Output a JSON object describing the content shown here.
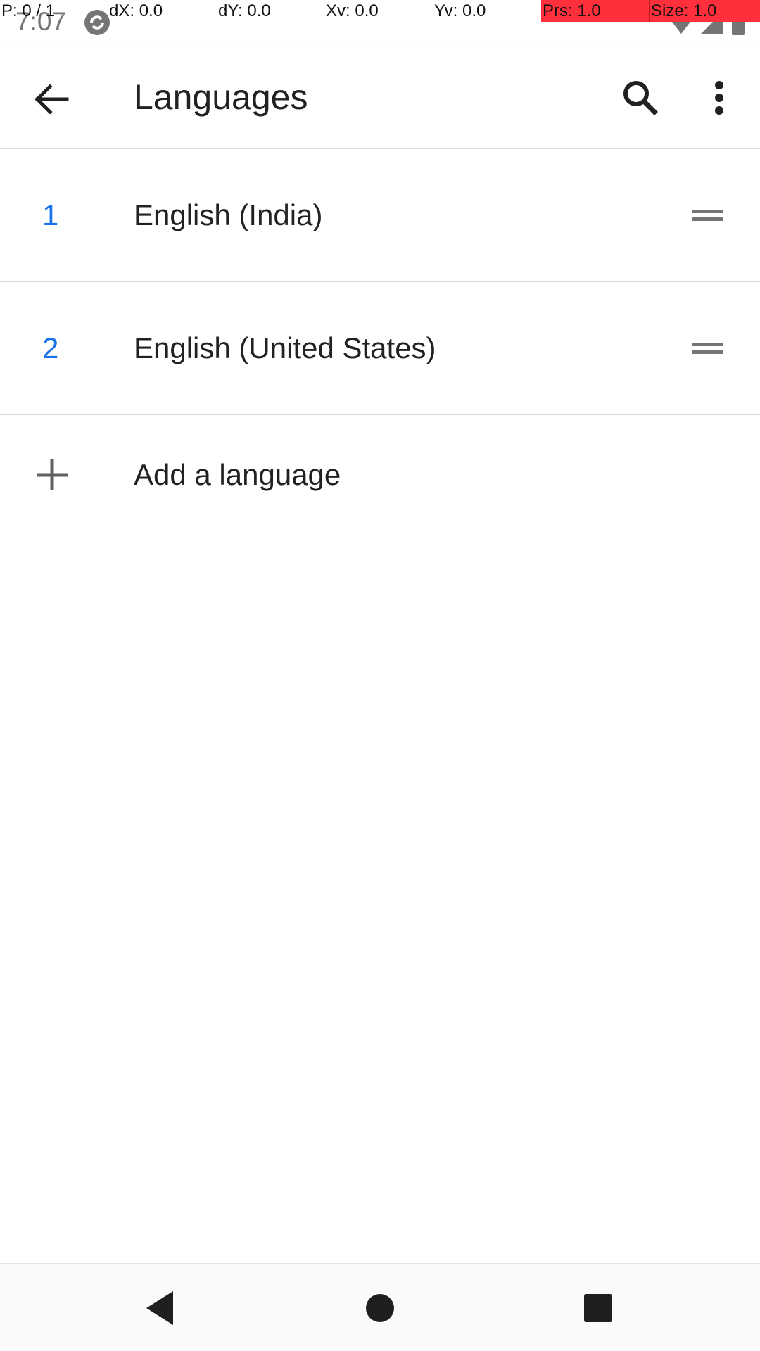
{
  "status_bar": {
    "time": "7:07",
    "app_icon": "sync-icon",
    "icons": [
      "wifi-icon",
      "cell-signal-icon",
      "battery-icon"
    ]
  },
  "debug_overlay": {
    "pointer": "P: 0 / 1",
    "dx": "dX: 0.0",
    "dy": "dY: 0.0",
    "xv": "Xv: 0.0",
    "yv": "Yv: 0.0",
    "prs": "Prs: 1.0",
    "size": "Size: 1.0",
    "highlight_color": "#ff2f3c"
  },
  "app_bar": {
    "title": "Languages",
    "back_icon": "arrow-back-icon",
    "search_icon": "search-icon",
    "more_icon": "more-vert-icon"
  },
  "languages": [
    {
      "index": "1",
      "name": "English (India)"
    },
    {
      "index": "2",
      "name": "English (United States)"
    }
  ],
  "add_language": {
    "label": "Add a language",
    "icon": "plus-icon"
  },
  "nav_bar": {
    "buttons": [
      "back-triangle-icon",
      "home-circle-icon",
      "recents-square-icon"
    ]
  },
  "colors": {
    "accent": "#1a73e8",
    "text": "#212121",
    "icon": "#757575"
  }
}
